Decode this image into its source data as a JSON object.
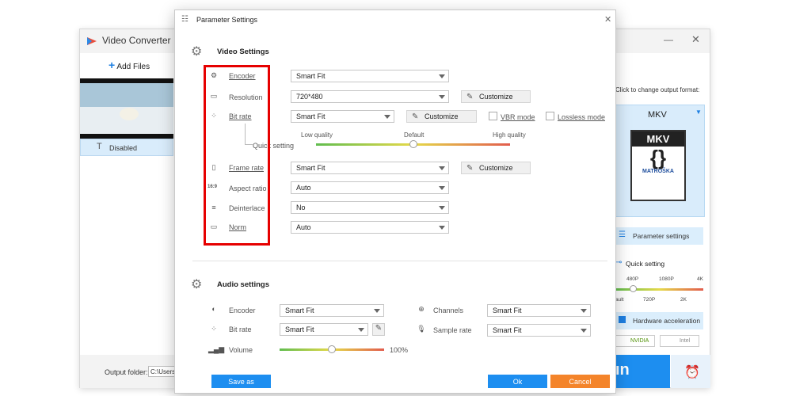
{
  "background_window": {
    "title": "Video Converter",
    "add_files": "Add Files",
    "subtitle_state": "Disabled",
    "output_folder_label": "Output folder:",
    "output_folder_value": "C:\\Users\\",
    "right_panel": {
      "hint": "Click to change output format:",
      "format": "MKV",
      "format_logo_text": "MKV",
      "format_logo_sub": "MATROŠKA",
      "parameter_settings": "Parameter settings",
      "quick_setting": "Quick setting",
      "res_ticks_top": [
        "480P",
        "1080P",
        "4K"
      ],
      "res_ticks_bottom": [
        "ault",
        "720P",
        "2K"
      ],
      "hardware_acceleration": "Hardware acceleration",
      "nvidia": "NVIDIA",
      "intel": "Intel",
      "run_fragment": "ın"
    }
  },
  "dialog": {
    "title": "Parameter Settings",
    "video_section": "Video Settings",
    "encoder_label": "Encoder",
    "encoder_value": "Smart Fit",
    "resolution_label": "Resolution",
    "resolution_value": "720*480",
    "bitrate_label": "Bit rate",
    "bitrate_value": "Smart Fit",
    "vbr_mode": "VBR mode",
    "lossless_mode": "Lossless mode",
    "customize": "Customize",
    "quick_setting": "Quick setting",
    "low_quality": "Low quality",
    "default": "Default",
    "high_quality": "High quality",
    "framerate_label": "Frame rate",
    "framerate_value": "Smart Fit",
    "aspect_label": "Aspect ratio",
    "aspect_value": "Auto",
    "aspect_icon_text": "16:9",
    "deinterlace_label": "Deinterlace",
    "deinterlace_value": "No",
    "norm_label": "Norm",
    "norm_value": "Auto",
    "audio_section": "Audio settings",
    "audio_encoder_label": "Encoder",
    "audio_encoder_value": "Smart Fit",
    "audio_bitrate_label": "Bit rate",
    "audio_bitrate_value": "Smart Fit",
    "volume_label": "Volume",
    "volume_value": "100%",
    "channels_label": "Channels",
    "channels_value": "Smart Fit",
    "samplerate_label": "Sample rate",
    "samplerate_value": "Smart Fit",
    "save_as": "Save as",
    "ok": "Ok",
    "cancel": "Cancel",
    "quality_slider_fraction": 0.5,
    "volume_slider_fraction": 0.5
  }
}
